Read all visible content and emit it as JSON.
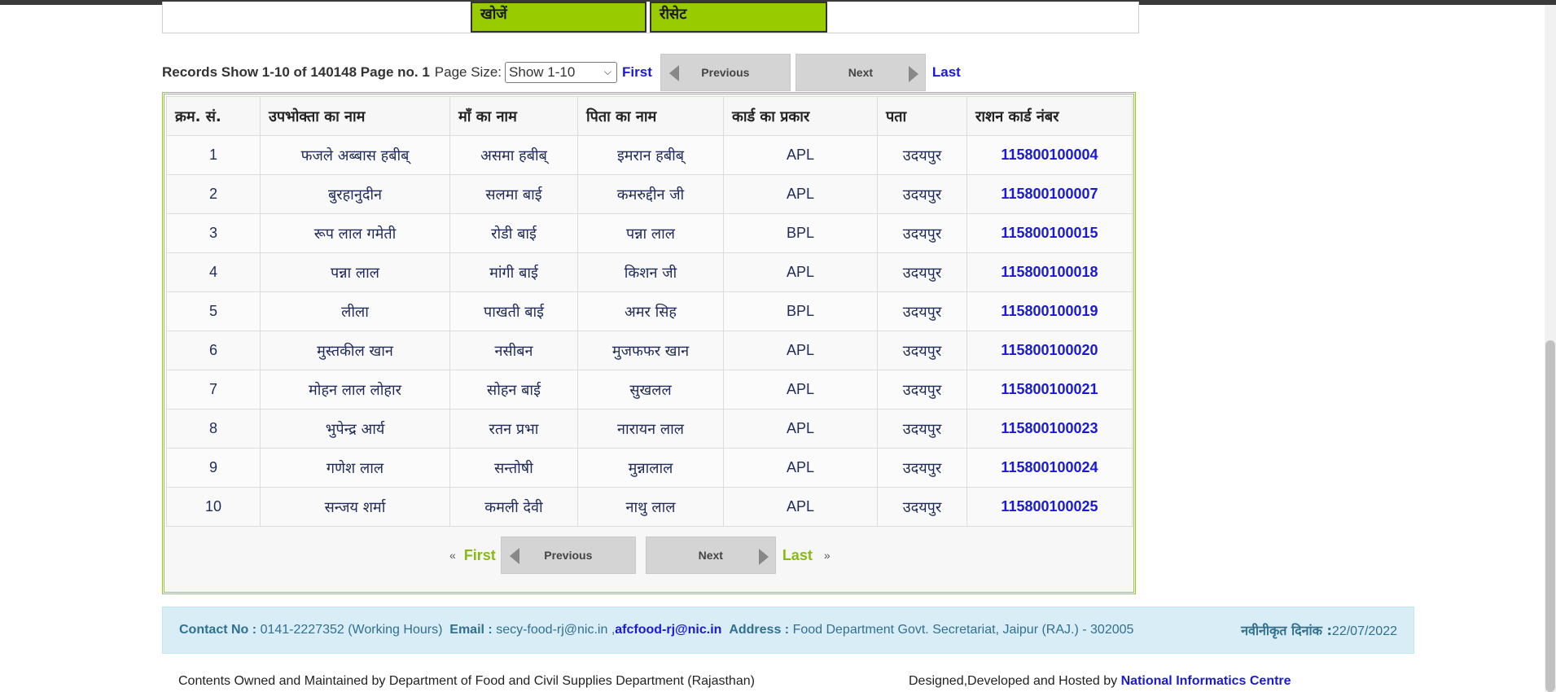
{
  "search": {
    "search_label": "खोजें",
    "reset_label": "रीसेट"
  },
  "pager": {
    "records_text": "Records Show 1-10 of 140148 Page no. 1",
    "page_size_label": "Page Size:",
    "page_size_value": "Show 1-10",
    "first": "First",
    "previous": "Previous",
    "next": "Next",
    "last": "Last"
  },
  "table": {
    "headers": [
      "क्रम. सं.",
      "उपभोक्ता का नाम",
      "माँ का नाम",
      "पिता का नाम",
      "कार्ड का प्रकार",
      "पता",
      "राशन कार्ड नंबर"
    ],
    "rows": [
      [
        "1",
        "फजले अब्बास हबीब्",
        "असमा हबीब्",
        "इमरान हबीब्",
        "APL",
        "उदयपुर",
        "115800100004"
      ],
      [
        "2",
        "बुरहानुदीन",
        "सलमा बाई",
        "कमरुद्दीन जी",
        "APL",
        "उदयपुर",
        "115800100007"
      ],
      [
        "3",
        "रूप लाल गमेती",
        "रोडी बाई",
        "पन्ना लाल",
        "BPL",
        "उदयपुर",
        "115800100015"
      ],
      [
        "4",
        "पन्ना लाल",
        "मांगी बाई",
        "किशन जी",
        "APL",
        "उदयपुर",
        "115800100018"
      ],
      [
        "5",
        "लीला",
        "पाखती बाई",
        "अमर सिह",
        "BPL",
        "उदयपुर",
        "115800100019"
      ],
      [
        "6",
        "मुस्तकील खान",
        "नसीबन",
        "मुजफफर खान",
        "APL",
        "उदयपुर",
        "115800100020"
      ],
      [
        "7",
        "मोहन लाल लोहार",
        "सोहन बाई",
        "सुखलल",
        "APL",
        "उदयपुर",
        "115800100021"
      ],
      [
        "8",
        "भुपेन्द्र आर्य",
        "रतन प्रभा",
        "नारायन लाल",
        "APL",
        "उदयपुर",
        "115800100023"
      ],
      [
        "9",
        "गणेश लाल",
        "सन्तोषी",
        "मुन्नालाल",
        "APL",
        "उदयपुर",
        "115800100024"
      ],
      [
        "10",
        "सन्जय शर्मा",
        "कमली देवी",
        "नाथु लाल",
        "APL",
        "उदयपुर",
        "115800100025"
      ]
    ]
  },
  "footer": {
    "contact_label": "Contact No :",
    "contact_value": "0141-2227352 (Working Hours)",
    "email_label": "Email :",
    "email_value": "secy-food-rj@nic.in ,",
    "email_value2": "afcfood-rj@nic.in",
    "address_label": "Address :",
    "address_value": "Food Department Govt. Secretariat, Jaipur (RAJ.) - 302005",
    "updated_label": "नवीनीकृत दिनांक :",
    "updated_value": "22/07/2022",
    "owned_text": "Contents Owned and Maintained by Department of Food and Civil Supplies Department (Rajasthan)",
    "designed_text": "Designed,Developed and Hosted by",
    "designed_link": "National Informatics Centre"
  }
}
